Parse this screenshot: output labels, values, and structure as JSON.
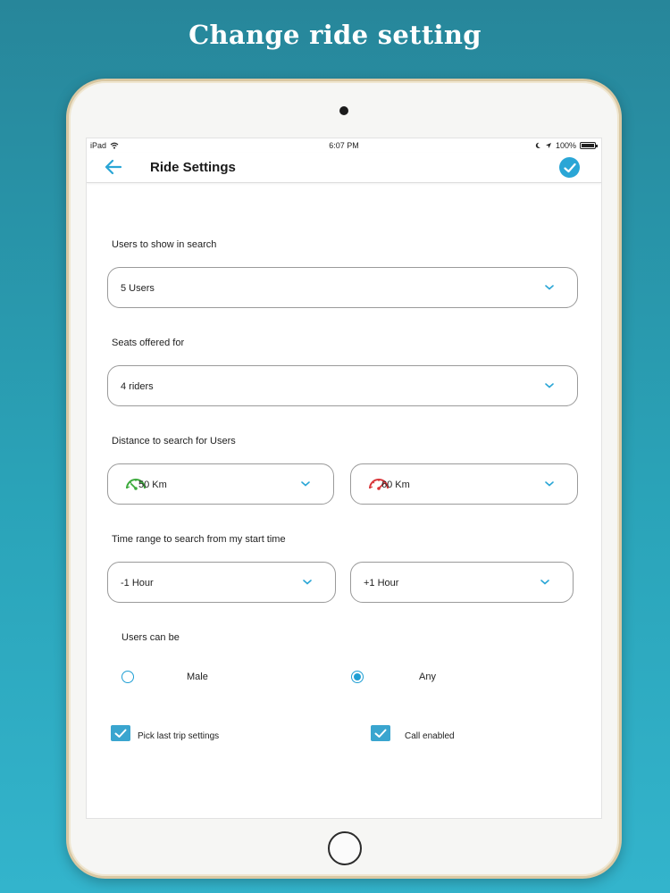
{
  "headline": "Change ride setting",
  "status_bar": {
    "device": "iPad",
    "time": "6:07 PM",
    "battery": "100%"
  },
  "nav": {
    "title": "Ride Settings"
  },
  "sections": {
    "users_to_show": {
      "label": "Users to show in search",
      "value": "5 Users"
    },
    "seats_offered": {
      "label": "Seats offered for",
      "value": "4 riders"
    },
    "distance": {
      "label": "Distance to search for Users",
      "min_value": "50 Km",
      "max_value": "60 Km"
    },
    "time_range": {
      "label": "Time range to search from my start time",
      "before_value": "-1 Hour",
      "after_value": "+1 Hour"
    },
    "gender": {
      "label": "Users can be",
      "options": [
        {
          "label": "Male",
          "selected": false
        },
        {
          "label": "Any",
          "selected": true
        }
      ]
    },
    "toggles": {
      "pick_last": {
        "label": "Pick last trip settings",
        "checked": true
      },
      "call_enabled": {
        "label": "Call enabled",
        "checked": true
      }
    }
  },
  "colors": {
    "accent": "#2aa6d6",
    "checkbox": "#3aa5cf",
    "gauge_min": "#3caa3c",
    "gauge_max": "#d9363a"
  }
}
